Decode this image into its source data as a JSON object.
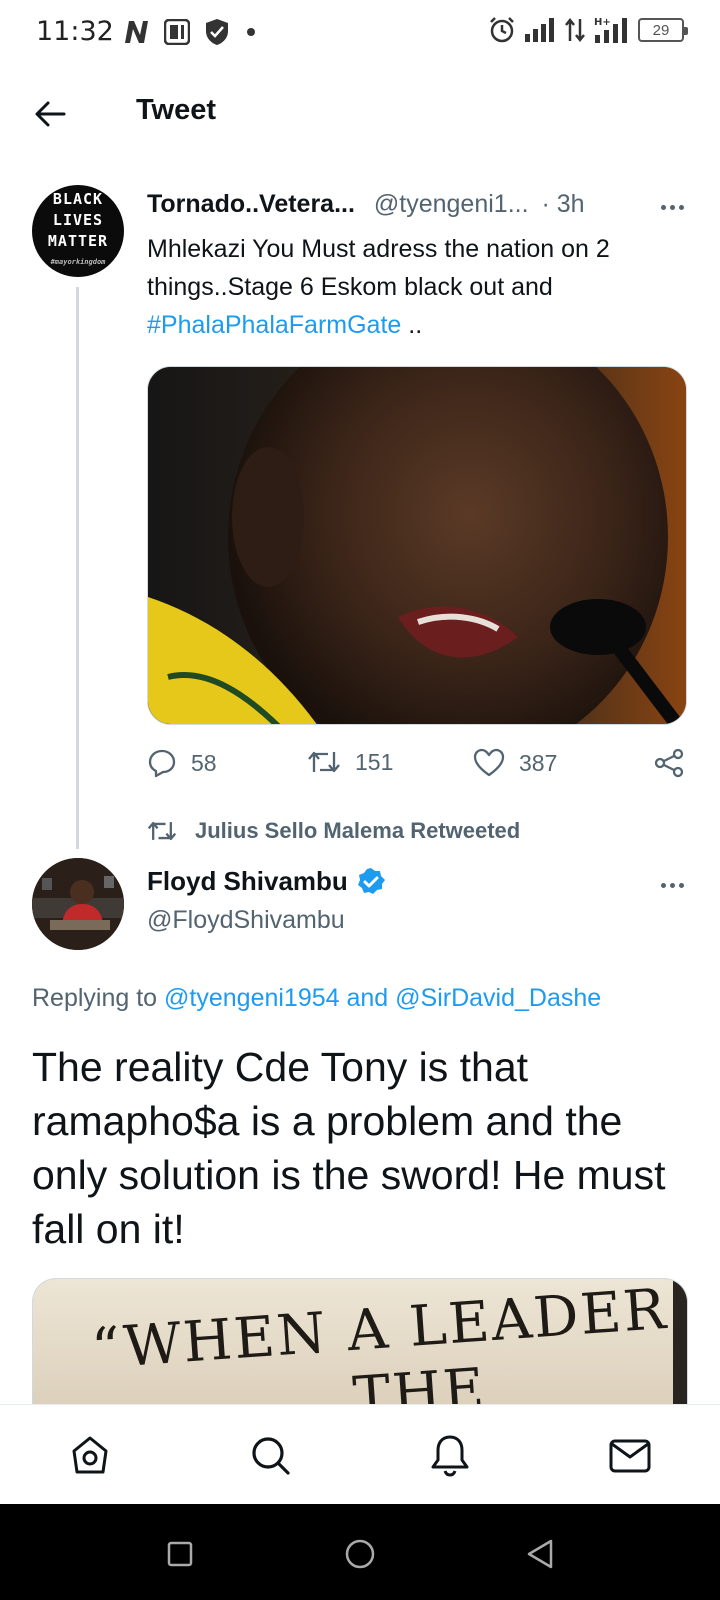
{
  "status_bar": {
    "time": "11:32",
    "battery": "29",
    "icons": [
      "n-notification-icon",
      "parking-notification-icon",
      "shield-icon",
      "dot-icon",
      "alarm-icon",
      "signal-icon",
      "data-arrows-icon",
      "h-plus-signal-icon",
      "battery-icon"
    ]
  },
  "header": {
    "title": "Tweet",
    "back_icon": "back-arrow-icon"
  },
  "tweet1": {
    "avatar_text": [
      "BLACK",
      "LIVES",
      "MATTER"
    ],
    "avatar_caption": "#mayorkingdom",
    "name": "Tornado..Vetera...",
    "handle": "@tyengeni1...",
    "time": "· 3h",
    "text_line1": "Mhlekazi You Must adress the nation on 2",
    "text_line2": "things..Stage 6 Eskom black out and",
    "hashtag": "#PhalaPhalaFarmGate",
    "text_tail": " ..",
    "actions": {
      "replies": "58",
      "retweets": "151",
      "likes": "387"
    }
  },
  "retweet_banner": "Julius Sello Malema Retweeted",
  "tweet2": {
    "name": "Floyd Shivambu",
    "handle": "@FloydShivambu",
    "replying_prefix": "Replying to ",
    "replying_user1": "@tyengeni1954",
    "replying_and": " and ",
    "replying_user2": "@SirDavid_Dashe",
    "text": "The reality Cde Tony is that ramapho$a is a problem and the only solution is the sword! He must fall on it!",
    "media_text": "“WHEN A LEADER",
    "media_text_partial": "THE"
  },
  "bottom_nav": [
    "home-icon",
    "search-icon",
    "notifications-icon",
    "messages-icon"
  ],
  "system_nav": [
    "recents-icon",
    "home-circle-icon",
    "back-triangle-icon"
  ],
  "colors": {
    "accent": "#1d9bf0",
    "text": "#0f1419",
    "secondary": "#536471"
  }
}
